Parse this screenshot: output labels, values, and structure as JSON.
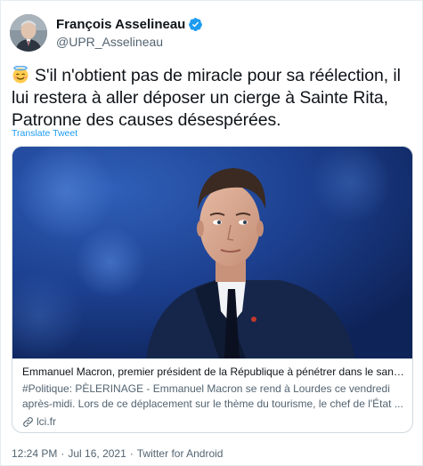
{
  "author": {
    "display_name": "François Asselineau",
    "handle": "@UPR_Asselineau",
    "verified": true,
    "verified_color": "#1d9bf0"
  },
  "tweet": {
    "emoji": "smiling-face-with-halo",
    "text": "S'il n'obtient pas de miracle pour sa réélection, il lui restera à aller déposer un cierge à Sainte Rita, Patronne des causes désespérées.",
    "translate_label": "Translate Tweet"
  },
  "card": {
    "title": "Emmanuel Macron, premier président de la République à pénétrer dans le sanct...",
    "description": "#Politique: PÈLERINAGE - Emmanuel Macron se rend à Lourdes ce vendredi après-midi. Lors de ce déplacement sur le thème du tourisme, le chef de l'État ...",
    "domain": "lci.fr",
    "image_background": "#1a3f8c"
  },
  "meta": {
    "time": "12:24 PM",
    "date": "Jul 16, 2021",
    "source": "Twitter for Android",
    "separator": "·"
  },
  "colors": {
    "link": "#1d9bf0",
    "secondary_text": "#536471",
    "border": "#cfd9de"
  }
}
